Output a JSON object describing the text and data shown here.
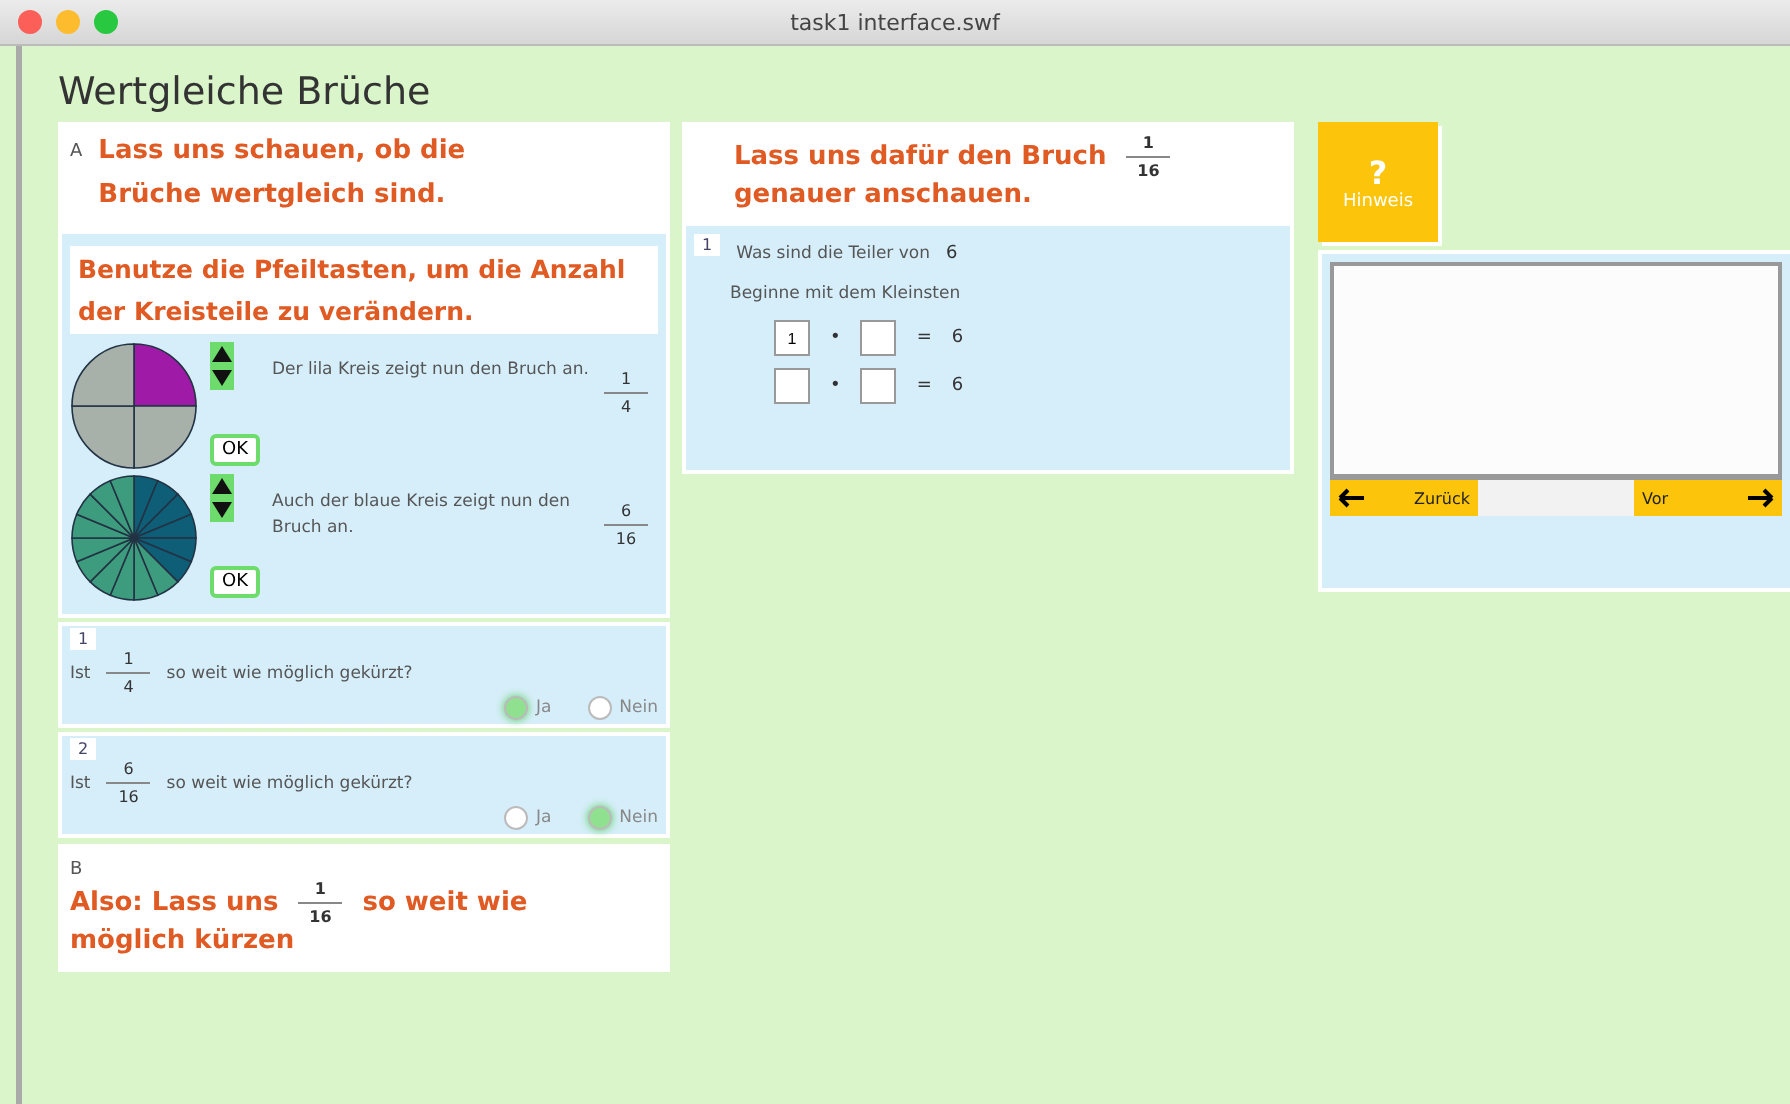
{
  "window": {
    "title": "task1 interface.swf"
  },
  "page_title": "Wertgleiche Brüche",
  "section_a": {
    "label": "A",
    "heading": "Lass uns schauen, ob die Brüche wertgleich sind.",
    "instruction": "Benutze die Pfeiltasten, um die Anzahl der Kreisteile zu verändern.",
    "circles": [
      {
        "color": "#a01aa8",
        "text": "Der lila Kreis zeigt nun den Bruch an.",
        "numerator": "1",
        "denominator": "4",
        "button": "OK"
      },
      {
        "color": "#0f5e78",
        "text": "Auch der blaue Kreis zeigt nun den Bruch an.",
        "numerator": "6",
        "denominator": "16",
        "button": "OK"
      }
    ],
    "questions": [
      {
        "number": "1",
        "prefix": "Ist",
        "numerator": "1",
        "denominator": "4",
        "suffix": "so weit wie möglich gekürzt?",
        "options": [
          {
            "label": "Ja",
            "selected": true
          },
          {
            "label": "Nein",
            "selected": false
          }
        ]
      },
      {
        "number": "2",
        "prefix": "Ist",
        "numerator": "6",
        "denominator": "16",
        "suffix": "so weit wie möglich gekürzt?",
        "options": [
          {
            "label": "Ja",
            "selected": false
          },
          {
            "label": "Nein",
            "selected": true
          }
        ]
      }
    ]
  },
  "section_b": {
    "label": "B",
    "before": "Also: Lass uns",
    "numerator": "1",
    "denominator": "16",
    "after": "so weit wie möglich kürzen"
  },
  "middle": {
    "heading": "Lass uns dafür den Bruch",
    "heading_numerator": "1",
    "heading_denominator": "16",
    "heading_line2": "genauer anschauen.",
    "step": "1",
    "question": "Was sind die Teiler von",
    "question_number": "6",
    "hint_text": "Beginne mit dem Kleinsten",
    "rows": [
      {
        "a": "1",
        "b": "",
        "times": "•",
        "equals": "=",
        "result": "6"
      },
      {
        "a": "",
        "b": "",
        "times": "•",
        "equals": "=",
        "result": "6"
      }
    ]
  },
  "hint": {
    "icon": "?",
    "label": "Hinweis",
    "back": "Zurück",
    "forward": "Vor"
  }
}
